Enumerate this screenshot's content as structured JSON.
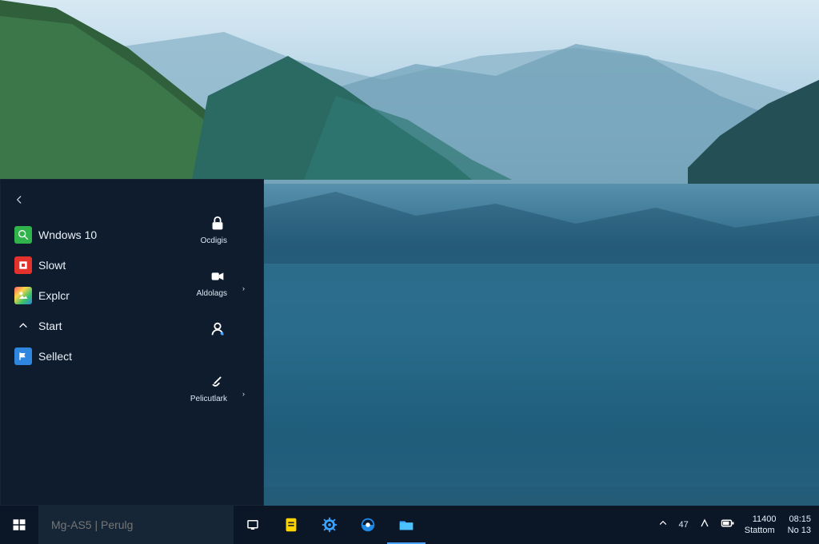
{
  "start_menu": {
    "apps": [
      {
        "label": "Wndows 10",
        "icon": "search-icon",
        "color": "#2fb34a"
      },
      {
        "label": "Slowt",
        "icon": "tile-icon",
        "color": "#e3322b"
      },
      {
        "label": "Explcr",
        "icon": "photo-icon",
        "color": "#ffd54a"
      },
      {
        "label": "Start",
        "icon": "chevron-up-icon",
        "color": "#ffffff"
      },
      {
        "label": "Sellect",
        "icon": "flag-icon",
        "color": "#2e86de"
      }
    ],
    "tiles": [
      {
        "label": "Ocdigis",
        "icon": "lock-icon"
      },
      {
        "label": "Aldolags",
        "icon": "video-icon"
      },
      {
        "label": "",
        "icon": "user-icon"
      },
      {
        "label": "Pelicutlark",
        "icon": "link-icon"
      }
    ]
  },
  "taskbar": {
    "search_placeholder": "Mg-AS5 | Perulg",
    "tray": {
      "number": "47",
      "time_left": "11400",
      "time_right": "08:15",
      "date_left": "Stattom",
      "date_right": "No 13"
    }
  },
  "colors": {
    "taskbar_bg": "#0b1726",
    "start_menu_bg": "#0f1c2d",
    "accent": "#4aa3ff"
  }
}
